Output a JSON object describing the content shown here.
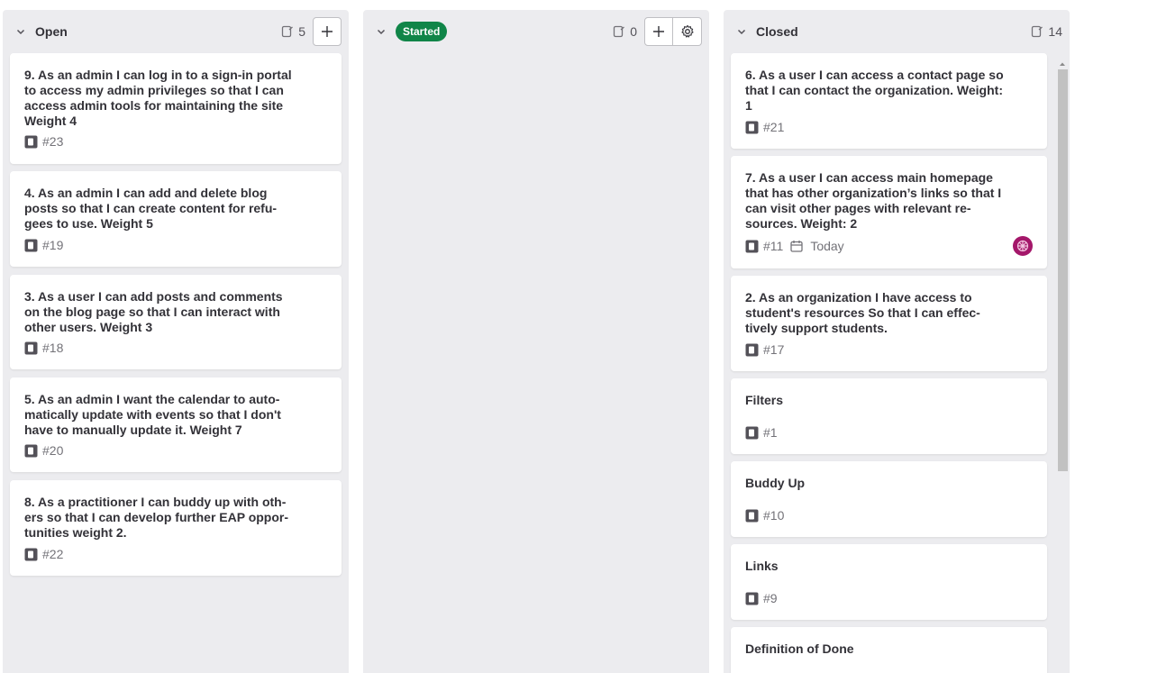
{
  "columns": [
    {
      "title": "Open",
      "count": "5",
      "cards": [
        {
          "title": "9. As an admin I can log in to a sign-in portal to access my admin privileges so that I can access admin tools for maintaining the site Weight 4",
          "number": "#23"
        },
        {
          "title": "4. As an admin I can add and delete blog posts so that I can create content for refu-gees to use. Weight 5",
          "number": "#19"
        },
        {
          "title": "3. As a user I can add posts and comments on the blog page so that I can interact with other users. Weight 3",
          "number": "#18"
        },
        {
          "title": "5. As an admin I want the calendar to auto-matically update with events so that I don't have to manually update it. Weight 7",
          "number": "#20"
        },
        {
          "title": "8. As a practitioner I can buddy up with oth-ers so that I can develop further EAP oppor-tunities weight 2.",
          "number": "#22"
        }
      ]
    },
    {
      "title": "Started",
      "count": "0",
      "cards": []
    },
    {
      "title": "Closed",
      "count": "14",
      "cards": [
        {
          "title": "6. As a user I can access a contact page so that I can contact the organization. Weight: 1",
          "number": "#21"
        },
        {
          "title": "7. As a user I can access main homepage that has other organization’s links so that I can visit other pages with relevant re-sources. Weight: 2",
          "number": "#11",
          "due": "Today",
          "has_avatar": true
        },
        {
          "title": "2. As an organization I have access to student's resources So that I can effec-tively support students.",
          "number": "#17"
        },
        {
          "title": "Filters",
          "number": "#1"
        },
        {
          "title": "Buddy Up",
          "number": "#10"
        },
        {
          "title": "Links",
          "number": "#9"
        },
        {
          "title": "Definition of Done",
          "number": ""
        }
      ]
    }
  ],
  "colors": {
    "column_bg": "#ececef",
    "started_pill": "#108548",
    "avatar": "#a4176a"
  },
  "icons": {
    "collapse": "chevron-down-icon",
    "count": "issues-count-icon",
    "add": "plus-icon",
    "settings": "gear-icon",
    "issue": "issue-type-icon",
    "due_date": "calendar-icon"
  }
}
